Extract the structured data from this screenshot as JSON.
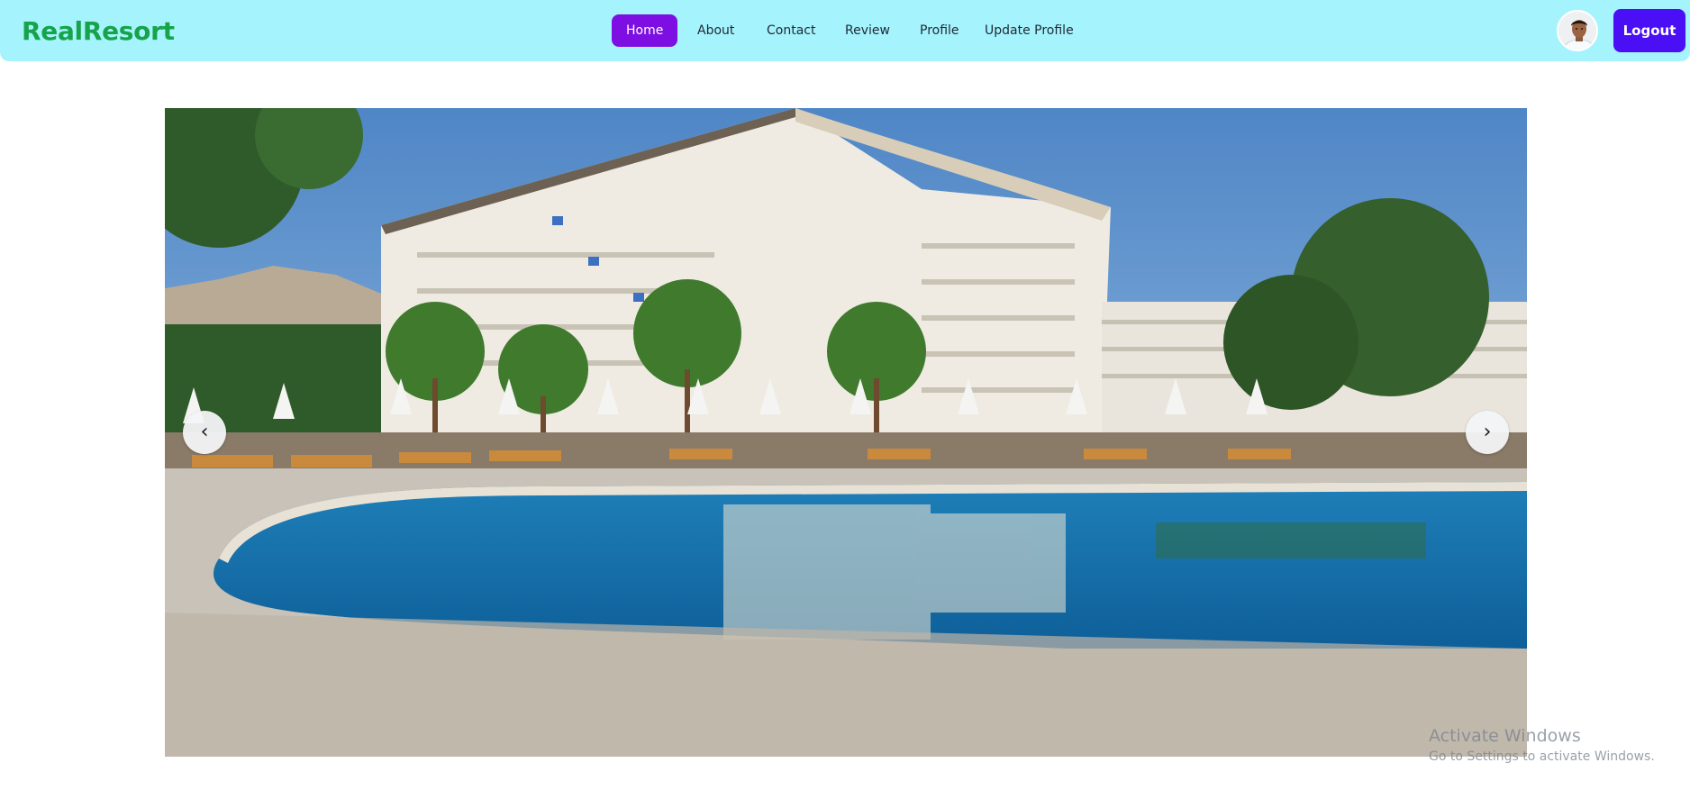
{
  "header": {
    "brand": "RealResort",
    "nav": [
      {
        "label": "Home",
        "active": true
      },
      {
        "label": "About",
        "active": false
      },
      {
        "label": "Contact",
        "active": false
      },
      {
        "label": "Review",
        "active": false
      },
      {
        "label": "Profile",
        "active": false
      },
      {
        "label": "Update Profile",
        "active": false
      }
    ],
    "logout_label": "Logout"
  },
  "carousel": {
    "prev_symbol": "‹",
    "next_symbol": "›"
  },
  "watermark": {
    "title": "Activate Windows",
    "subtitle": "Go to Settings to activate Windows."
  },
  "colors": {
    "navbar_bg": "#a5f3fc",
    "brand": "#16a34a",
    "active_nav": "#7e0fe3",
    "logout": "#4a0ff5"
  }
}
